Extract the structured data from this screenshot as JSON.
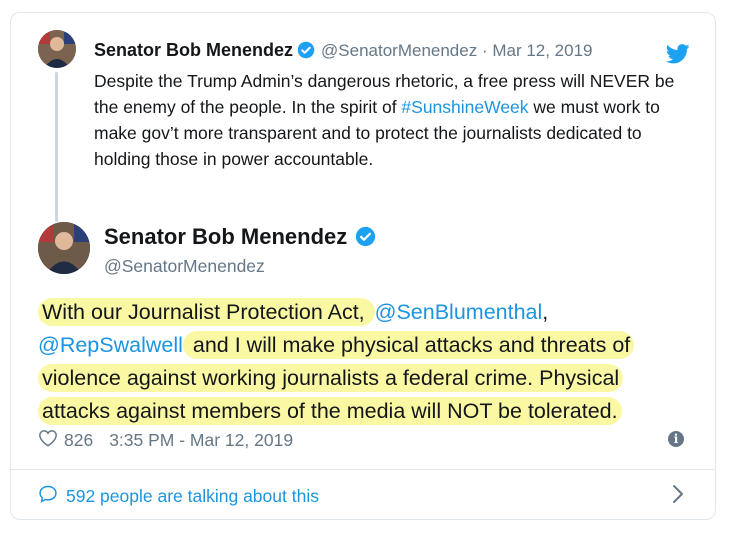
{
  "quoted_tweet": {
    "name": "Senator Bob Menendez",
    "handle_date": "@SenatorMenendez · Mar 12, 2019",
    "text_1": "Despite the Trump Admin’s dangerous rhetoric, a free press will NEVER be the enemy of the people. In the spirit of ",
    "hashtag": "#SunshineWeek",
    "text_2": " we must work to make gov’t more transparent and to protect the journalists dedicated to holding those in power accountable."
  },
  "tweet": {
    "name": "Senator Bob Menendez",
    "handle": "@SenatorMenendez",
    "text_1": "With our Journalist Protection Act, ",
    "mention_1": "@SenBlumenthal",
    "text_2": ",",
    "mention_2": "@RepSwalwell",
    "text_3": " and I will make physical attacks and threats of violence against working journalists a federal crime. Physical attacks against members of the media will NOT be tolerated.",
    "likes": "826",
    "timestamp": "3:35 PM - Mar 12, 2019"
  },
  "footer": {
    "talking": "592 people are talking about this"
  },
  "icons": {
    "verified": "verified-badge-icon",
    "bird": "twitter-bird-icon",
    "heart": "heart-icon",
    "info": "info-icon",
    "speech": "speech-bubble-icon",
    "chevron": "chevron-right-icon"
  },
  "colors": {
    "link": "#1b95e0",
    "highlight": "#fbf8a4",
    "muted": "#657786",
    "border": "#e1e8ed"
  }
}
